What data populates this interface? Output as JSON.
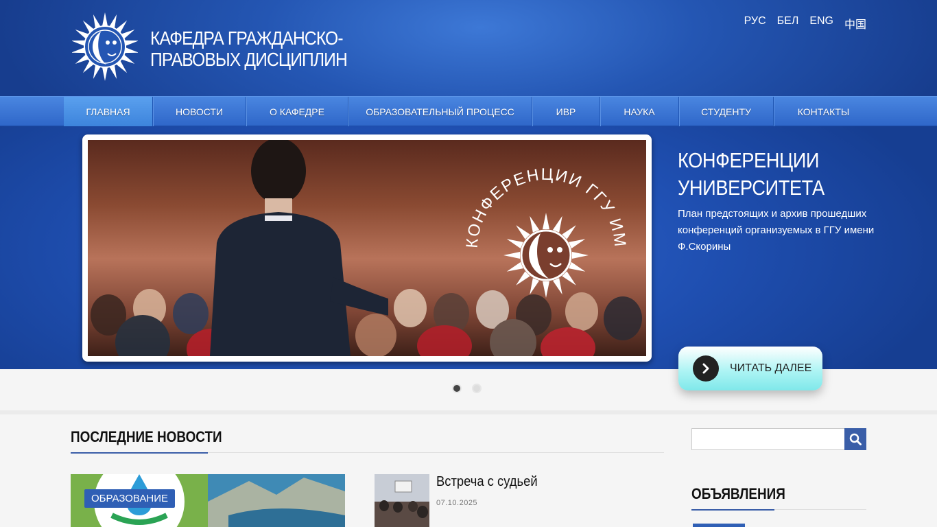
{
  "header": {
    "title_line1": "Кафедра гражданско-",
    "title_line2": "правовых дисциплин",
    "languages": [
      "РУС",
      "БЕЛ",
      "ENG",
      "中国"
    ]
  },
  "nav": {
    "items": [
      {
        "label": "Главная",
        "active": true
      },
      {
        "label": "Новости"
      },
      {
        "label": "О кафедре"
      },
      {
        "label": "Образовательный процесс"
      },
      {
        "label": "ИВР"
      },
      {
        "label": "Наука"
      },
      {
        "label": "Студенту"
      },
      {
        "label": "Контакты"
      }
    ]
  },
  "slider": {
    "title": "Конференции университета",
    "text": "План предстоящих и архив прошедших конференций организуемых в ГГУ имени Ф.Скорины",
    "image_caption": "КОНФЕРЕНЦИИ ГГУ ИМЕНИ Ф.СКОРИНЫ",
    "read_more": "Читать далее",
    "current_slide": 1,
    "slide_count": 2
  },
  "news": {
    "heading": "Последние новости",
    "featured_badge": "Образование",
    "posts": [
      {
        "title": "Встреча с судьей",
        "date": "07.10.2025"
      }
    ]
  },
  "sidebar": {
    "search_placeholder": "",
    "announcements_heading": "Объявления"
  },
  "colors": {
    "accent": "#3a5ea8",
    "header_blue": "#2456b3",
    "nav_blue": "#3d78d6"
  }
}
